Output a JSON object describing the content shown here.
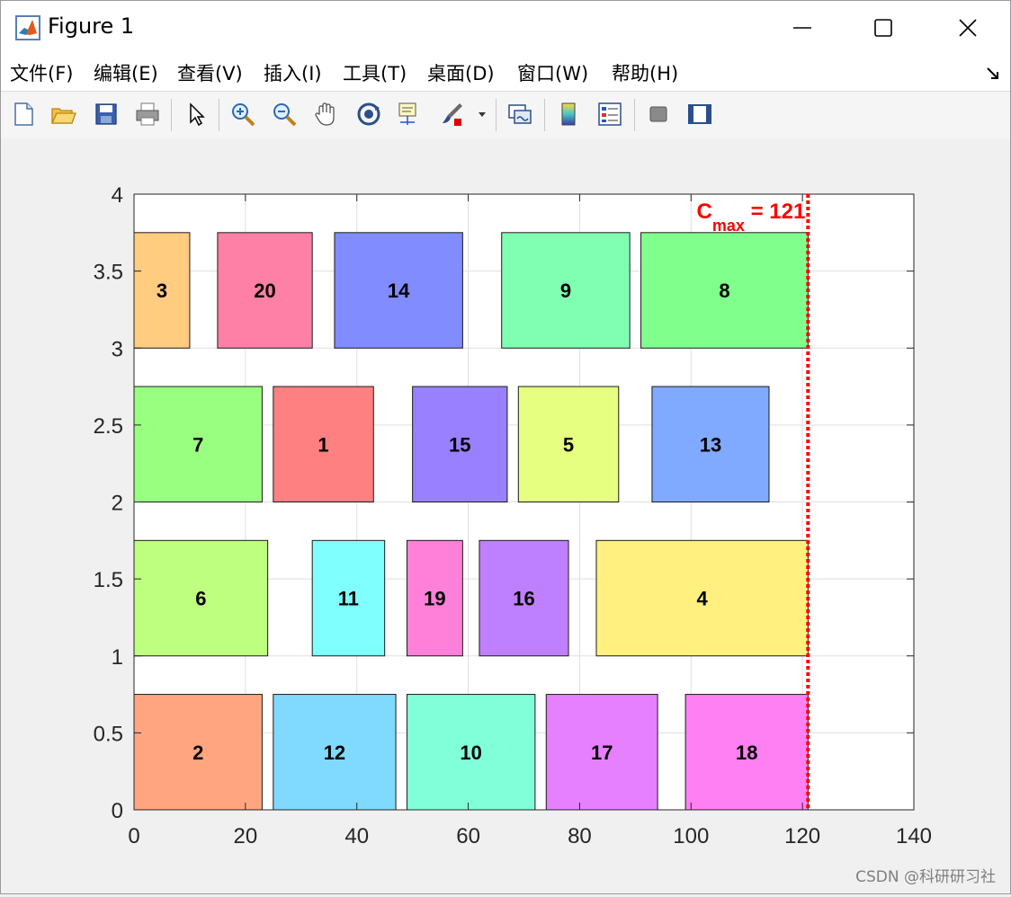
{
  "window": {
    "title": "Figure 1",
    "controls": {
      "minimize": "minimize-icon",
      "maximize": "maximize-icon",
      "close": "close-icon"
    }
  },
  "menu": {
    "items": [
      "文件(F)",
      "编辑(E)",
      "查看(V)",
      "插入(I)",
      "工具(T)",
      "桌面(D)",
      "窗口(W)",
      "帮助(H)"
    ]
  },
  "toolbar": {
    "icons": [
      "new-figure-icon",
      "open-file-icon",
      "save-icon",
      "print-icon",
      "select-pointer-icon",
      "zoom-in-icon",
      "zoom-out-icon",
      "pan-hand-icon",
      "rotate-3d-icon",
      "data-cursor-icon",
      "brush-icon",
      "brush-dropdown-icon",
      "link-plot-icon",
      "colorbar-icon",
      "legend-icon",
      "hide-plot-tools-icon",
      "show-plot-tools-icon"
    ]
  },
  "watermark": "CSDN @科研研习社",
  "chart_data": {
    "type": "gantt",
    "title": "",
    "xlabel": "",
    "ylabel": "",
    "xlim": [
      0,
      140
    ],
    "ylim": [
      0,
      4
    ],
    "xticks": [
      0,
      20,
      40,
      60,
      80,
      100,
      120,
      140
    ],
    "yticks": [
      0,
      0.5,
      1,
      1.5,
      2,
      2.5,
      3,
      3.5,
      4
    ],
    "ytick_labels": [
      "0",
      "0.5",
      "1",
      "1.5",
      "2",
      "2.5",
      "3",
      "3.5",
      "4"
    ],
    "grid": true,
    "cmax": 121,
    "cmax_label": {
      "prefix": "C",
      "subscript": "max",
      "suffix": " = 121"
    },
    "cmax_color": "#ff0000",
    "rows": [
      {
        "y0": 0,
        "y1": 0.75,
        "tasks": [
          {
            "job": "2",
            "start": 0,
            "end": 23,
            "color": "#ffa680"
          },
          {
            "job": "12",
            "start": 25,
            "end": 47,
            "color": "#80d9ff"
          },
          {
            "job": "10",
            "start": 49,
            "end": 72,
            "color": "#80ffd9"
          },
          {
            "job": "17",
            "start": 74,
            "end": 94,
            "color": "#e680ff"
          },
          {
            "job": "18",
            "start": 99,
            "end": 121,
            "color": "#ff80f2"
          }
        ]
      },
      {
        "y0": 1,
        "y1": 1.75,
        "tasks": [
          {
            "job": "6",
            "start": 0,
            "end": 24,
            "color": "#bfff80"
          },
          {
            "job": "11",
            "start": 32,
            "end": 45,
            "color": "#80ffff"
          },
          {
            "job": "19",
            "start": 49,
            "end": 59,
            "color": "#ff80d9"
          },
          {
            "job": "16",
            "start": 62,
            "end": 78,
            "color": "#bf80ff"
          },
          {
            "job": "4",
            "start": 83,
            "end": 121,
            "color": "#fff080"
          }
        ]
      },
      {
        "y0": 2,
        "y1": 2.75,
        "tasks": [
          {
            "job": "7",
            "start": 0,
            "end": 23,
            "color": "#99ff80"
          },
          {
            "job": "1",
            "start": 25,
            "end": 43,
            "color": "#ff8080"
          },
          {
            "job": "15",
            "start": 50,
            "end": 67,
            "color": "#9980ff"
          },
          {
            "job": "5",
            "start": 69,
            "end": 87,
            "color": "#e6ff80"
          },
          {
            "job": "13",
            "start": 93,
            "end": 114,
            "color": "#80aaff"
          }
        ]
      },
      {
        "y0": 3,
        "y1": 3.75,
        "tasks": [
          {
            "job": "3",
            "start": 0,
            "end": 10,
            "color": "#ffcc80"
          },
          {
            "job": "20",
            "start": 15,
            "end": 32,
            "color": "#ff80a6"
          },
          {
            "job": "14",
            "start": 36,
            "end": 59,
            "color": "#808cff"
          },
          {
            "job": "9",
            "start": 66,
            "end": 89,
            "color": "#80ffb3"
          },
          {
            "job": "8",
            "start": 91,
            "end": 121,
            "color": "#80ff8c"
          }
        ]
      }
    ]
  }
}
